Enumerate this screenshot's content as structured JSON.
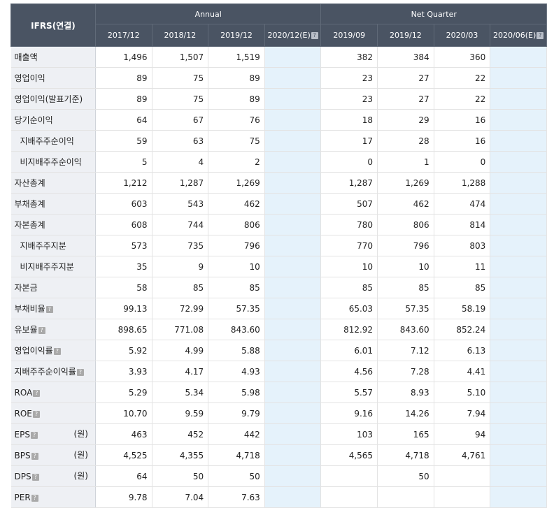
{
  "header": {
    "corner": "IFRS(연결)",
    "annual_label": "Annual",
    "quarter_label": "Net Quarter",
    "columns": [
      "2017/12",
      "2018/12",
      "2019/12",
      "2020/12(E)",
      "2019/09",
      "2019/12",
      "2020/03",
      "2020/06(E)"
    ],
    "help_icon_char": "?"
  },
  "rows": [
    {
      "label": "매출액",
      "sub": false,
      "help": false,
      "unit": "",
      "values": [
        "1,496",
        "1,507",
        "1,519",
        "",
        "382",
        "384",
        "360",
        ""
      ]
    },
    {
      "label": "영업이익",
      "sub": false,
      "help": false,
      "unit": "",
      "values": [
        "89",
        "75",
        "89",
        "",
        "23",
        "27",
        "22",
        ""
      ]
    },
    {
      "label": "영업이익(발표기준)",
      "sub": false,
      "help": false,
      "unit": "",
      "values": [
        "89",
        "75",
        "89",
        "",
        "23",
        "27",
        "22",
        ""
      ]
    },
    {
      "label": "당기순이익",
      "sub": false,
      "help": false,
      "unit": "",
      "values": [
        "64",
        "67",
        "76",
        "",
        "18",
        "29",
        "16",
        ""
      ]
    },
    {
      "label": "지배주주순이익",
      "sub": true,
      "help": false,
      "unit": "",
      "values": [
        "59",
        "63",
        "75",
        "",
        "17",
        "28",
        "16",
        ""
      ]
    },
    {
      "label": "비지배주주순이익",
      "sub": true,
      "help": false,
      "unit": "",
      "values": [
        "5",
        "4",
        "2",
        "",
        "0",
        "1",
        "0",
        ""
      ]
    },
    {
      "label": "자산총계",
      "sub": false,
      "help": false,
      "unit": "",
      "values": [
        "1,212",
        "1,287",
        "1,269",
        "",
        "1,287",
        "1,269",
        "1,288",
        ""
      ]
    },
    {
      "label": "부채총계",
      "sub": false,
      "help": false,
      "unit": "",
      "values": [
        "603",
        "543",
        "462",
        "",
        "507",
        "462",
        "474",
        ""
      ]
    },
    {
      "label": "자본총계",
      "sub": false,
      "help": false,
      "unit": "",
      "values": [
        "608",
        "744",
        "806",
        "",
        "780",
        "806",
        "814",
        ""
      ]
    },
    {
      "label": "지배주주지분",
      "sub": true,
      "help": false,
      "unit": "",
      "values": [
        "573",
        "735",
        "796",
        "",
        "770",
        "796",
        "803",
        ""
      ]
    },
    {
      "label": "비지배주주지분",
      "sub": true,
      "help": false,
      "unit": "",
      "values": [
        "35",
        "9",
        "10",
        "",
        "10",
        "10",
        "11",
        ""
      ]
    },
    {
      "label": "자본금",
      "sub": false,
      "help": false,
      "unit": "",
      "values": [
        "58",
        "85",
        "85",
        "",
        "85",
        "85",
        "85",
        ""
      ]
    },
    {
      "label": "부채비율",
      "sub": false,
      "help": true,
      "unit": "",
      "values": [
        "99.13",
        "72.99",
        "57.35",
        "",
        "65.03",
        "57.35",
        "58.19",
        ""
      ]
    },
    {
      "label": "유보율",
      "sub": false,
      "help": true,
      "unit": "",
      "values": [
        "898.65",
        "771.08",
        "843.60",
        "",
        "812.92",
        "843.60",
        "852.24",
        ""
      ]
    },
    {
      "label": "영업이익률",
      "sub": false,
      "help": true,
      "unit": "",
      "values": [
        "5.92",
        "4.99",
        "5.88",
        "",
        "6.01",
        "7.12",
        "6.13",
        ""
      ]
    },
    {
      "label": "지배주주순이익률",
      "sub": false,
      "help": true,
      "unit": "",
      "values": [
        "3.93",
        "4.17",
        "4.93",
        "",
        "4.56",
        "7.28",
        "4.41",
        ""
      ]
    },
    {
      "label": "ROA",
      "sub": false,
      "help": true,
      "unit": "",
      "values": [
        "5.29",
        "5.34",
        "5.98",
        "",
        "5.57",
        "8.93",
        "5.10",
        ""
      ]
    },
    {
      "label": "ROE",
      "sub": false,
      "help": true,
      "unit": "",
      "values": [
        "10.70",
        "9.59",
        "9.79",
        "",
        "9.16",
        "14.26",
        "7.94",
        ""
      ]
    },
    {
      "label": "EPS",
      "sub": false,
      "help": true,
      "unit": "(원)",
      "values": [
        "463",
        "452",
        "442",
        "",
        "103",
        "165",
        "94",
        ""
      ]
    },
    {
      "label": "BPS",
      "sub": false,
      "help": true,
      "unit": "(원)",
      "values": [
        "4,525",
        "4,355",
        "4,718",
        "",
        "4,565",
        "4,718",
        "4,761",
        ""
      ]
    },
    {
      "label": "DPS",
      "sub": false,
      "help": true,
      "unit": "(원)",
      "values": [
        "64",
        "50",
        "50",
        "",
        "",
        "50",
        "",
        ""
      ]
    },
    {
      "label": "PER",
      "sub": false,
      "help": true,
      "unit": "",
      "values": [
        "9.78",
        "7.04",
        "7.63",
        "",
        "",
        "",
        "",
        ""
      ]
    }
  ]
}
